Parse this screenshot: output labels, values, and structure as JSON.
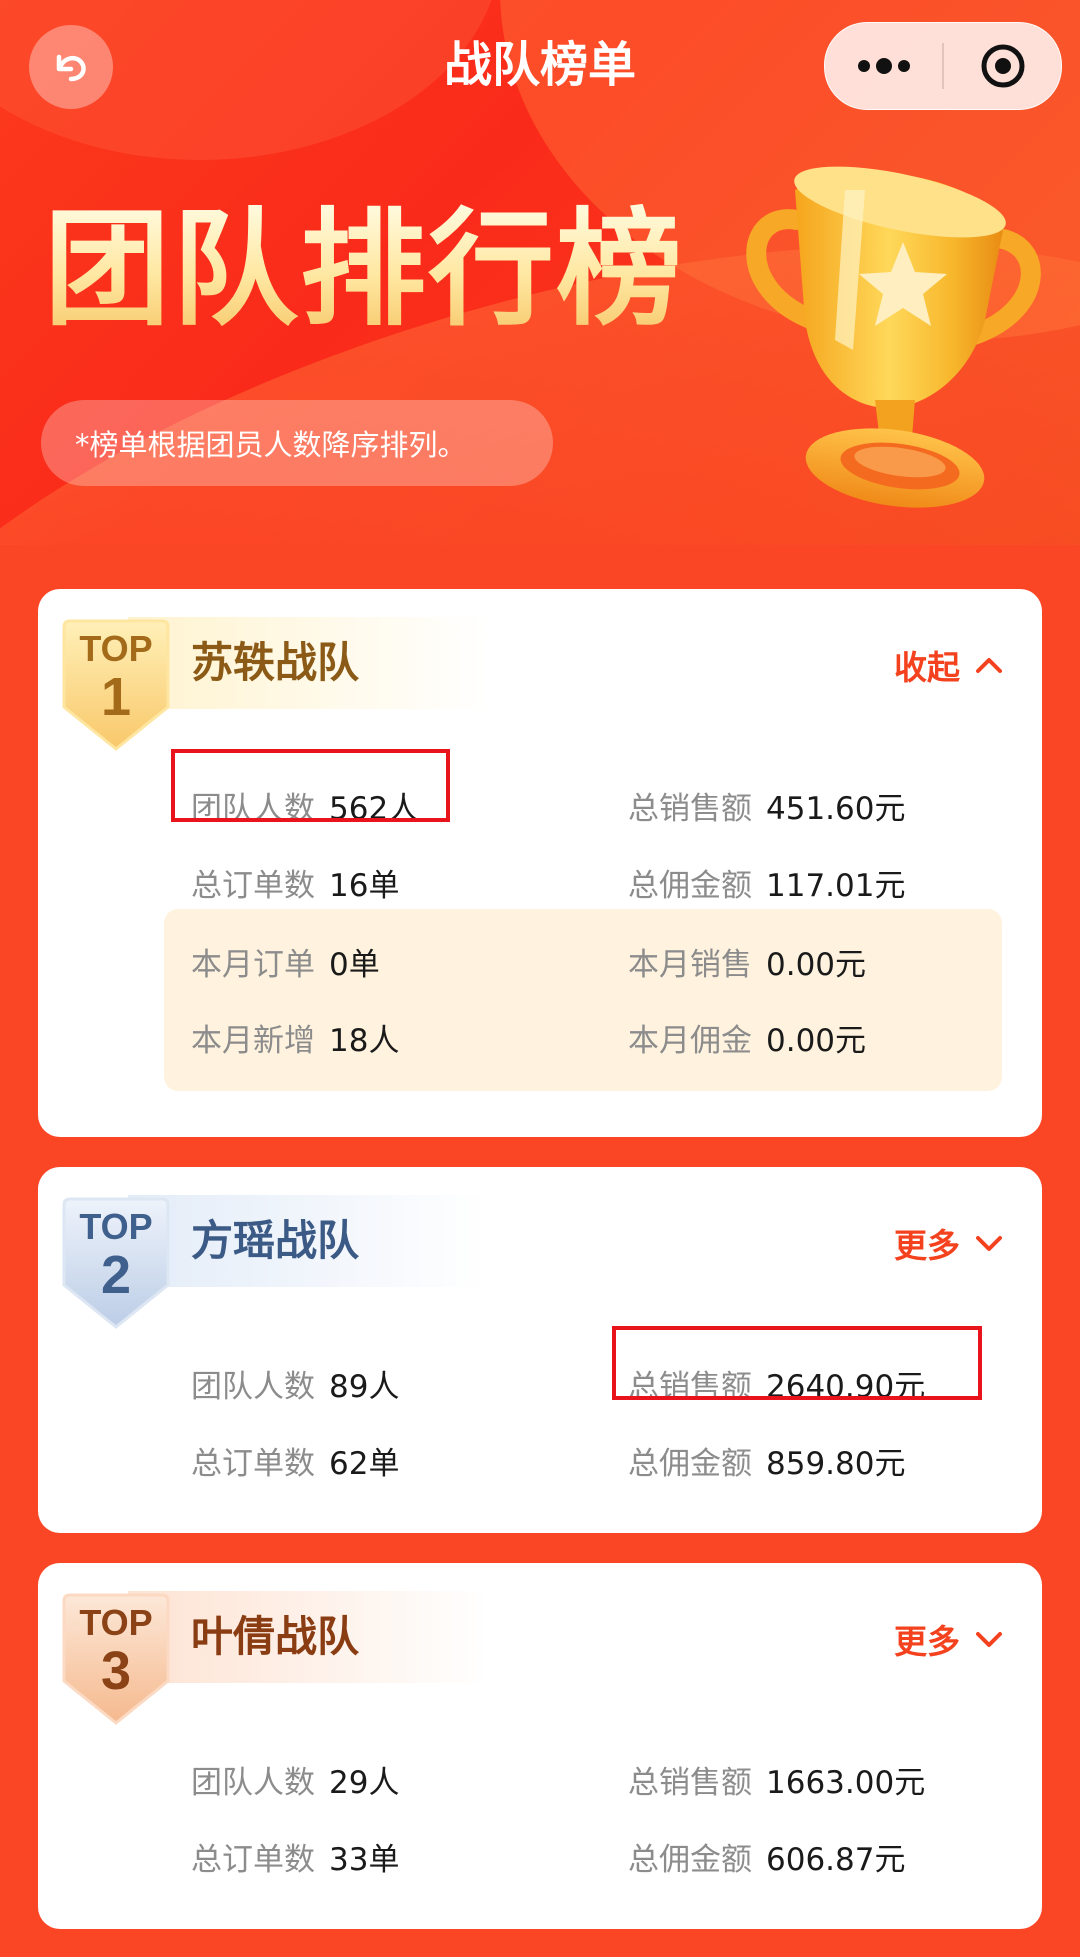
{
  "nav": {
    "title": "战队榜单",
    "back_icon": "back-arrow-icon",
    "menu_icon": "more-dots-icon",
    "close_icon": "target-circle-icon"
  },
  "banner": {
    "title": "团队排行榜",
    "note": "*榜单根据团员人数降序排列。"
  },
  "colors": {
    "background": "#fb4626",
    "accent": "#f4421f",
    "highlight_border": "#e8131b"
  },
  "teams": [
    {
      "top_label": "TOP",
      "rank": "1",
      "name": "苏轶战队",
      "toggle_label": "收起",
      "toggle_icon": "chevron-up-icon",
      "stats": {
        "members_label": "团队人数",
        "members_value": "562人",
        "sales_label": "总销售额",
        "sales_value": "451.60元",
        "orders_label": "总订单数",
        "orders_value": "16单",
        "commission_label": "总佣金额",
        "commission_value": "117.01元"
      },
      "monthly": {
        "orders_label": "本月订单",
        "orders_value": "0单",
        "sales_label": "本月销售",
        "sales_value": "0.00元",
        "new_label": "本月新增",
        "new_value": "18人",
        "commission_label": "本月佣金",
        "commission_value": "0.00元"
      }
    },
    {
      "top_label": "TOP",
      "rank": "2",
      "name": "方瑶战队",
      "toggle_label": "更多",
      "toggle_icon": "chevron-down-icon",
      "stats": {
        "members_label": "团队人数",
        "members_value": "89人",
        "sales_label": "总销售额",
        "sales_value": "2640.90元",
        "orders_label": "总订单数",
        "orders_value": "62单",
        "commission_label": "总佣金额",
        "commission_value": "859.80元"
      }
    },
    {
      "top_label": "TOP",
      "rank": "3",
      "name": "叶倩战队",
      "toggle_label": "更多",
      "toggle_icon": "chevron-down-icon",
      "stats": {
        "members_label": "团队人数",
        "members_value": "29人",
        "sales_label": "总销售额",
        "sales_value": "1663.00元",
        "orders_label": "总订单数",
        "orders_value": "33单",
        "commission_label": "总佣金额",
        "commission_value": "606.87元"
      }
    }
  ]
}
